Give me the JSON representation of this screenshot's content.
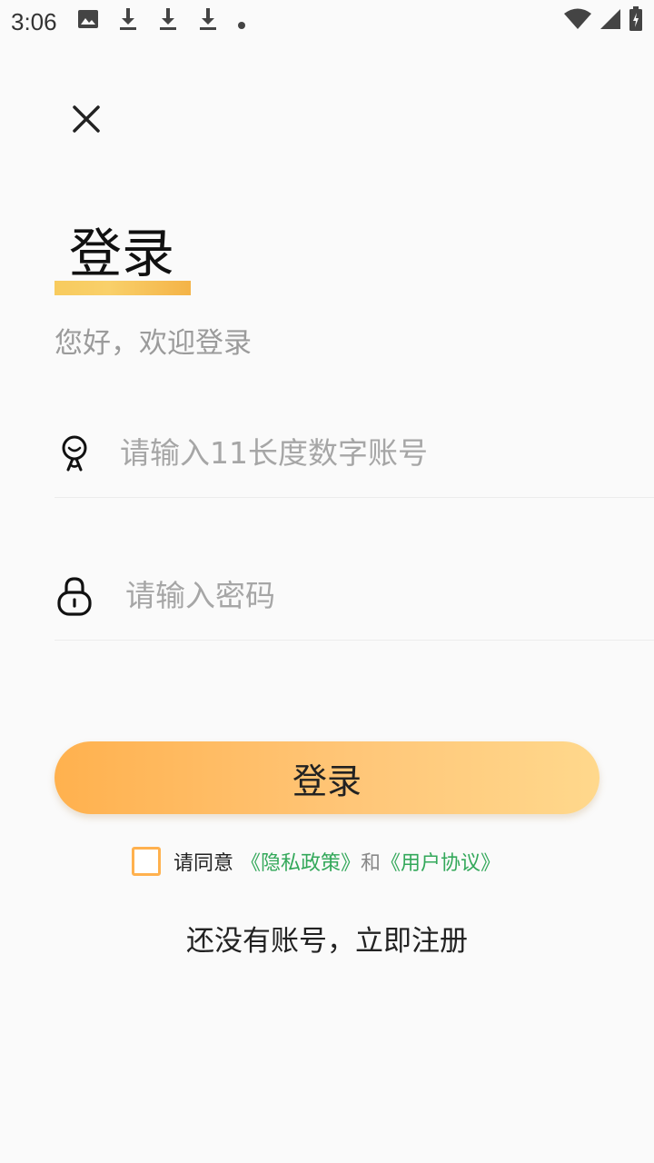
{
  "status_bar": {
    "time": "3:06",
    "icons": [
      "image-icon",
      "download-icon",
      "download-icon",
      "download-icon",
      "dot-icon",
      "wifi-icon",
      "signal-icon",
      "battery-icon"
    ]
  },
  "page": {
    "title": "登录",
    "welcome": "您好，欢迎登录"
  },
  "form": {
    "account_placeholder": "请输入11长度数字账号",
    "password_placeholder": "请输入密码",
    "login_label": "登录"
  },
  "agreement": {
    "prefix": "请同意",
    "privacy_link": "《隐私政策》",
    "and": "和",
    "user_link": "《用户协议》"
  },
  "register": {
    "label": "还没有账号，立即注册"
  },
  "colors": {
    "accent": "#ffb14e",
    "link": "#33a85a",
    "underline": "#f8cb5e"
  }
}
